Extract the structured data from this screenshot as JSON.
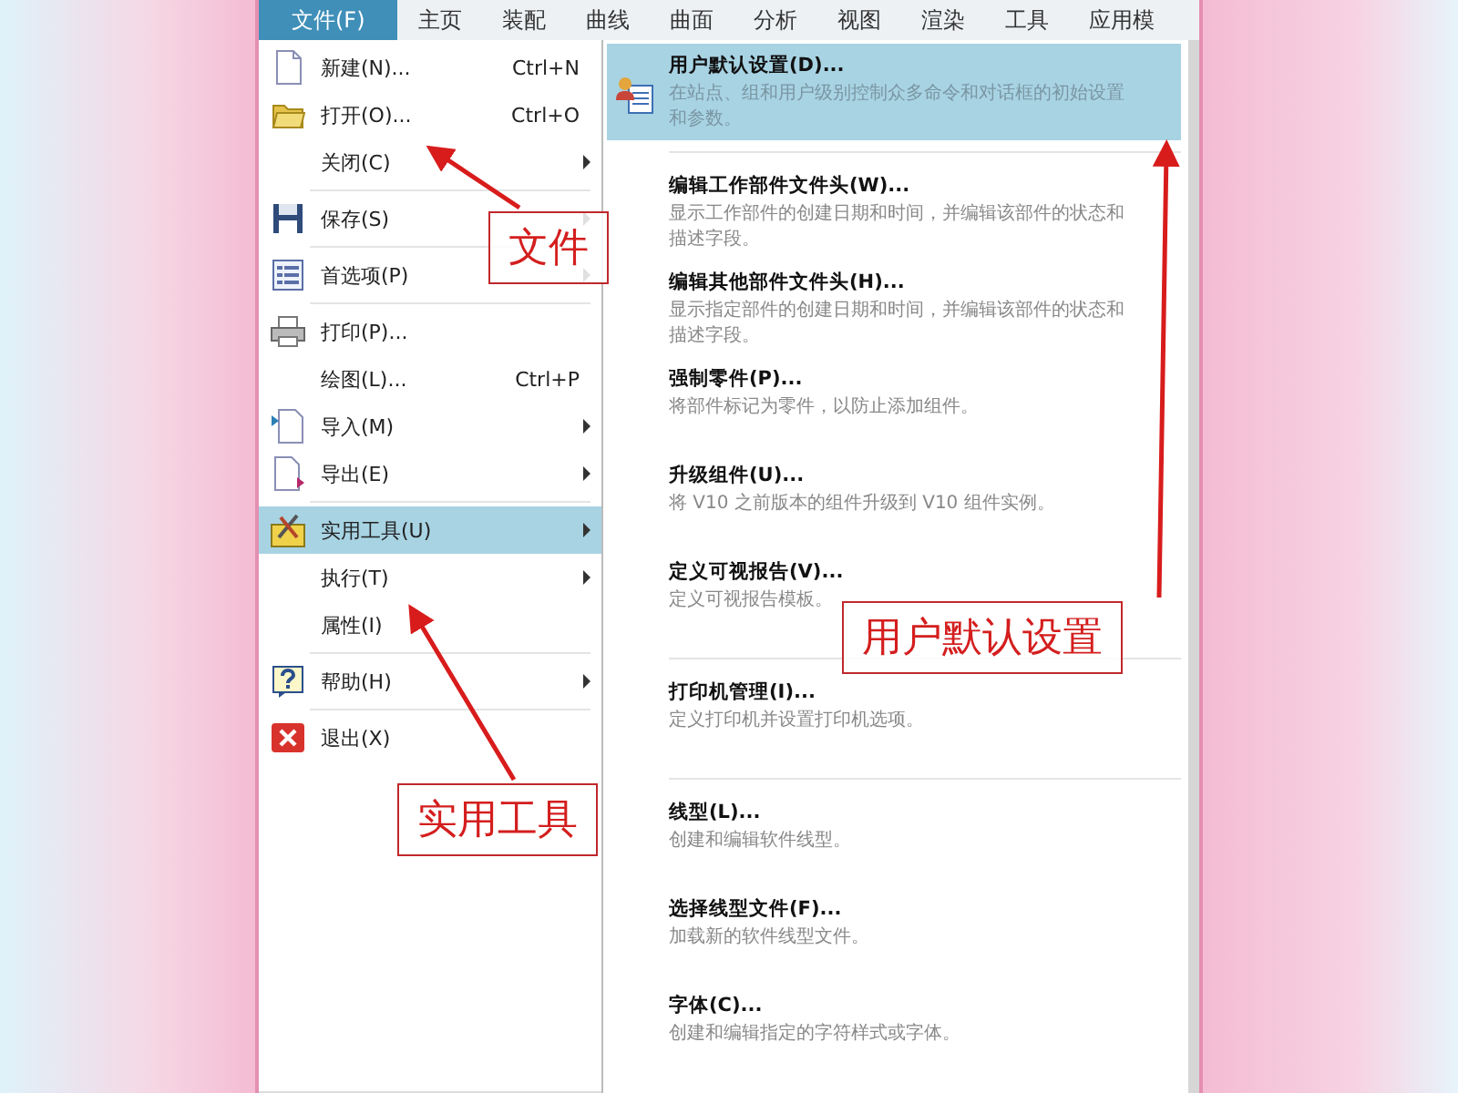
{
  "tabs": [
    {
      "label": "文件(F)",
      "selected": true
    },
    {
      "label": "主页",
      "selected": false
    },
    {
      "label": "装配",
      "selected": false
    },
    {
      "label": "曲线",
      "selected": false
    },
    {
      "label": "曲面",
      "selected": false
    },
    {
      "label": "分析",
      "selected": false
    },
    {
      "label": "视图",
      "selected": false
    },
    {
      "label": "渲染",
      "selected": false
    },
    {
      "label": "工具",
      "selected": false
    },
    {
      "label": "应用模",
      "selected": false
    }
  ],
  "file_menu": {
    "groups": [
      {
        "items": [
          {
            "label": "新建(N)...",
            "shortcut": "Ctrl+N",
            "submenu": false,
            "selected": false
          },
          {
            "label": "打开(O)...",
            "shortcut": "Ctrl+O",
            "submenu": false,
            "selected": false
          },
          {
            "label": "关闭(C)",
            "submenu": true,
            "selected": false
          }
        ]
      },
      {
        "items": [
          {
            "label": "保存(S)",
            "submenu": true,
            "selected": false
          }
        ]
      },
      {
        "items": [
          {
            "label": "首选项(P)",
            "submenu": true,
            "selected": false
          }
        ]
      },
      {
        "items": [
          {
            "label": "打印(P)...",
            "submenu": false,
            "selected": false
          },
          {
            "label": "绘图(L)...",
            "shortcut": "Ctrl+P",
            "submenu": false,
            "selected": false
          },
          {
            "label": "导入(M)",
            "submenu": true,
            "selected": false
          },
          {
            "label": "导出(E)",
            "submenu": true,
            "selected": false
          }
        ]
      },
      {
        "items": [
          {
            "label": "实用工具(U)",
            "submenu": true,
            "selected": true
          },
          {
            "label": "执行(T)",
            "submenu": true,
            "selected": false
          },
          {
            "label": "属性(I)",
            "submenu": false,
            "selected": false
          }
        ]
      },
      {
        "items": [
          {
            "label": "帮助(H)",
            "submenu": true,
            "selected": false
          }
        ]
      },
      {
        "items": [
          {
            "label": "退出(X)",
            "submenu": false,
            "selected": false
          }
        ]
      }
    ]
  },
  "submenu": {
    "groups": [
      {
        "items": [
          {
            "title": "用户默认设置(D)...",
            "description": "在站点、组和用户级别控制众多命令和对话框的初始设置和参数。",
            "selected": true
          }
        ]
      },
      {
        "items": [
          {
            "title": "编辑工作部件文件头(W)...",
            "description": "显示工作部件的创建日期和时间，并编辑该部件的状态和描述字段。",
            "selected": false
          },
          {
            "title": "编辑其他部件文件头(H)...",
            "description": "显示指定部件的创建日期和时间，并编辑该部件的状态和描述字段。",
            "selected": false
          },
          {
            "title": "强制零件(P)...",
            "description": "将部件标记为零件，以防止添加组件。",
            "selected": false
          },
          {
            "title": "升级组件(U)...",
            "description": "将 V10 之前版本的组件升级到 V10 组件实例。",
            "selected": false
          },
          {
            "title": "定义可视报告(V)...",
            "description": "定义可视报告模板。",
            "selected": false
          }
        ]
      },
      {
        "items": [
          {
            "title": "打印机管理(I)...",
            "description": "定义打印机并设置打印机选项。",
            "selected": false
          }
        ]
      },
      {
        "items": [
          {
            "title": "线型(L)...",
            "description": "创建和编辑软件线型。",
            "selected": false
          },
          {
            "title": "选择线型文件(F)...",
            "description": "加载新的软件线型文件。",
            "selected": false
          },
          {
            "title": "字体(C)...",
            "description": "创建和编辑指定的字符样式或字体。",
            "selected": false
          }
        ]
      }
    ]
  },
  "annotations": [
    {
      "text": "文件"
    },
    {
      "text": "实用工具"
    },
    {
      "text": "用户默认设置"
    }
  ]
}
